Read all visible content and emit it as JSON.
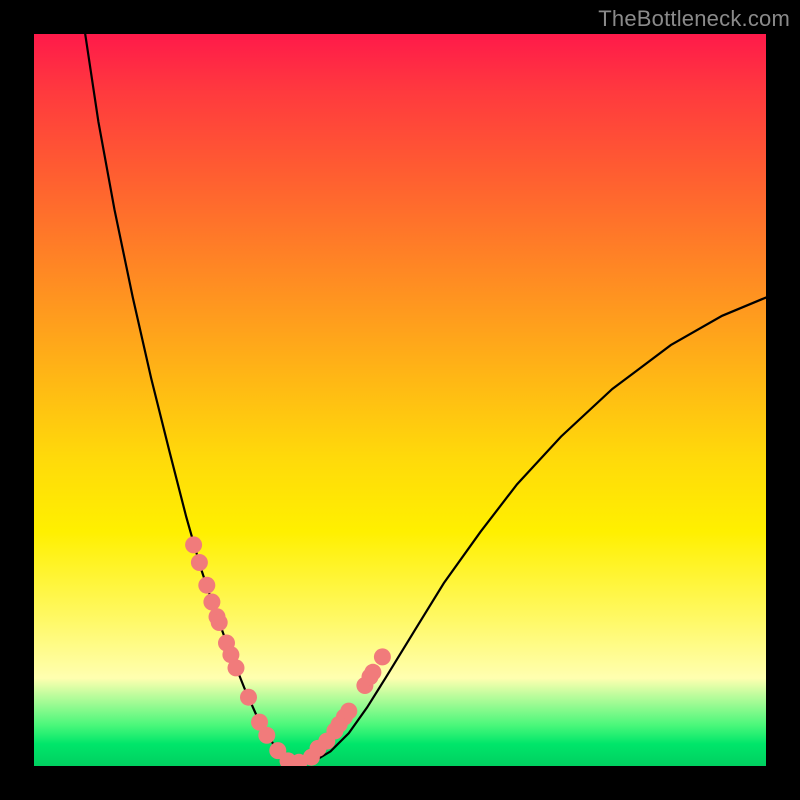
{
  "watermark": "TheBottleneck.com",
  "colors": {
    "frame": "#000000",
    "curve": "#000000",
    "dot_fill": "#f17b7b",
    "dot_stroke": "#d94f4f",
    "gradient_top": "#ff1a4a",
    "gradient_bottom": "#00d060"
  },
  "chart_data": {
    "type": "line",
    "title": "",
    "xlabel": "",
    "ylabel": "",
    "xlim": [
      0,
      1
    ],
    "ylim": [
      0,
      1
    ],
    "note": "Axes are unlabeled; y=1 means top of plot, y=0 bottom. Curve is a V-shaped bottleneck reaching y≈0 near x≈0.35, rising to y≈1 at x≈0.07 and y≈0.64 at x=1.",
    "series": [
      {
        "name": "bottleneck-curve",
        "x": [
          0.07,
          0.088,
          0.11,
          0.135,
          0.16,
          0.185,
          0.208,
          0.228,
          0.248,
          0.268,
          0.288,
          0.308,
          0.33,
          0.355,
          0.38,
          0.405,
          0.43,
          0.455,
          0.48,
          0.52,
          0.56,
          0.61,
          0.66,
          0.72,
          0.79,
          0.87,
          0.94,
          1.0
        ],
        "y": [
          1.0,
          0.88,
          0.76,
          0.64,
          0.53,
          0.43,
          0.34,
          0.27,
          0.21,
          0.155,
          0.105,
          0.06,
          0.025,
          0.005,
          0.005,
          0.02,
          0.045,
          0.08,
          0.12,
          0.185,
          0.25,
          0.32,
          0.385,
          0.45,
          0.515,
          0.575,
          0.615,
          0.64
        ]
      }
    ],
    "scatter_points": {
      "name": "highlighted-samples",
      "x": [
        0.218,
        0.226,
        0.236,
        0.243,
        0.25,
        0.253,
        0.263,
        0.269,
        0.276,
        0.293,
        0.308,
        0.318,
        0.333,
        0.347,
        0.362,
        0.379,
        0.388,
        0.4,
        0.411,
        0.417,
        0.424,
        0.43,
        0.452,
        0.459,
        0.463,
        0.476
      ],
      "y": [
        0.302,
        0.278,
        0.247,
        0.224,
        0.204,
        0.196,
        0.168,
        0.152,
        0.134,
        0.094,
        0.06,
        0.042,
        0.021,
        0.007,
        0.005,
        0.012,
        0.024,
        0.034,
        0.048,
        0.057,
        0.067,
        0.075,
        0.11,
        0.122,
        0.128,
        0.149
      ]
    }
  }
}
